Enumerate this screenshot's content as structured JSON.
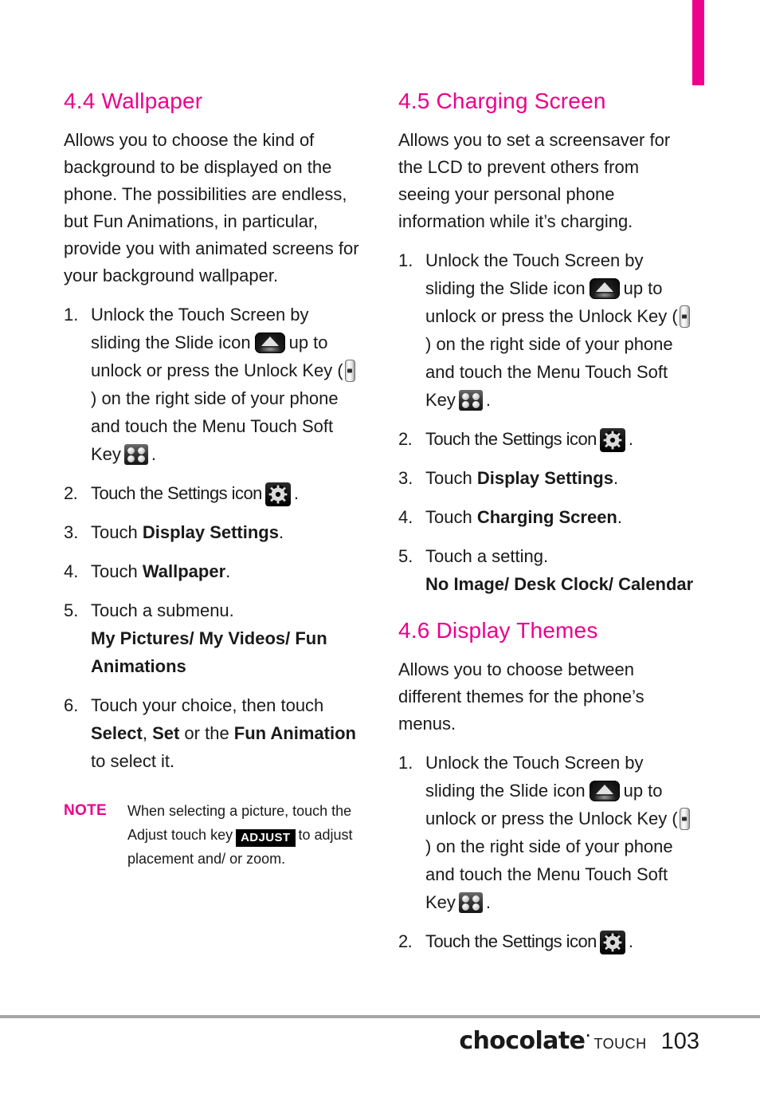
{
  "page": {
    "number": "103",
    "brand": "chocolate",
    "brand_mark": "·",
    "brand_sub": "TOUCH",
    "accent_color": "#ec008c",
    "rule_color": "#a6a6a6"
  },
  "left_column": {
    "section_44": {
      "title": "4.4 Wallpaper",
      "intro": "Allows you to choose the kind of background to be displayed on the phone. The possibilities are endless, but Fun Animations, in particular, provide you with animated screens for your background wallpaper.",
      "steps": [
        {
          "num": "1.",
          "text_a": "Unlock the Touch Screen by sliding the Slide icon",
          "icon_a": "slide-icon",
          "text_b": "up to unlock or press the Unlock Key (",
          "icon_b": "unlock-side-key-icon",
          "text_c": ") on the right side of your phone and touch the Menu Touch Soft Key",
          "icon_c": "menu-soft-key-icon",
          "text_d": "."
        },
        {
          "num": "2.",
          "text_a": "Touch the Settings icon",
          "icon_a": "settings-gear-icon",
          "text_b": "."
        },
        {
          "num": "3.",
          "text_a": "Touch ",
          "bold_a": "Display Settings",
          "text_b": "."
        },
        {
          "num": "4.",
          "text_a": "Touch ",
          "bold_a": "Wallpaper",
          "text_b": "."
        },
        {
          "num": "5.",
          "text_a": "Touch a submenu.",
          "sub_bold": "My Pictures/ My Videos/ Fun Animations"
        },
        {
          "num": "6.",
          "text_a": "Touch your choice, then touch ",
          "bold_a": "Select",
          "text_b": ", ",
          "bold_b": "Set",
          "text_c": " or the ",
          "bold_c": "Fun Animation",
          "text_d": " to select it."
        }
      ],
      "note": {
        "label": "NOTE",
        "text_a": "When selecting a picture, touch the Adjust touch key",
        "badge": "ADJUST",
        "text_b": "to adjust placement and/ or zoom."
      }
    }
  },
  "right_column": {
    "section_45": {
      "title": "4.5 Charging Screen",
      "intro": "Allows you to set a screensaver for the LCD to prevent others from seeing your personal phone information while it’s charging.",
      "steps": [
        {
          "num": "1.",
          "text_a": "Unlock the Touch Screen by sliding the Slide icon",
          "icon_a": "slide-icon",
          "text_b": "up to unlock or press the Unlock Key (",
          "icon_b": "unlock-side-key-icon",
          "text_c": ") on the right side of your phone and touch the Menu Touch Soft Key",
          "icon_c": "menu-soft-key-icon",
          "text_d": "."
        },
        {
          "num": "2.",
          "text_a": "Touch the Settings icon",
          "icon_a": "settings-gear-icon",
          "text_b": "."
        },
        {
          "num": "3.",
          "text_a": "Touch ",
          "bold_a": "Display Settings",
          "text_b": "."
        },
        {
          "num": "4.",
          "text_a": "Touch ",
          "bold_a": "Charging Screen",
          "text_b": "."
        },
        {
          "num": "5.",
          "text_a": "Touch a setting.",
          "sub_bold": "No Image/ Desk Clock/ Calendar"
        }
      ]
    },
    "section_46": {
      "title": "4.6 Display Themes",
      "intro": "Allows you to choose between different themes for the phone’s menus.",
      "steps": [
        {
          "num": "1.",
          "text_a": "Unlock the Touch Screen by sliding the Slide icon",
          "icon_a": "slide-icon",
          "text_b": "up to unlock or press the Unlock Key (",
          "icon_b": "unlock-side-key-icon",
          "text_c": ") on the right side of your phone and touch the Menu Touch Soft Key",
          "icon_c": "menu-soft-key-icon",
          "text_d": "."
        },
        {
          "num": "2.",
          "text_a": "Touch the Settings icon",
          "icon_a": "settings-gear-icon",
          "text_b": "."
        }
      ]
    }
  }
}
